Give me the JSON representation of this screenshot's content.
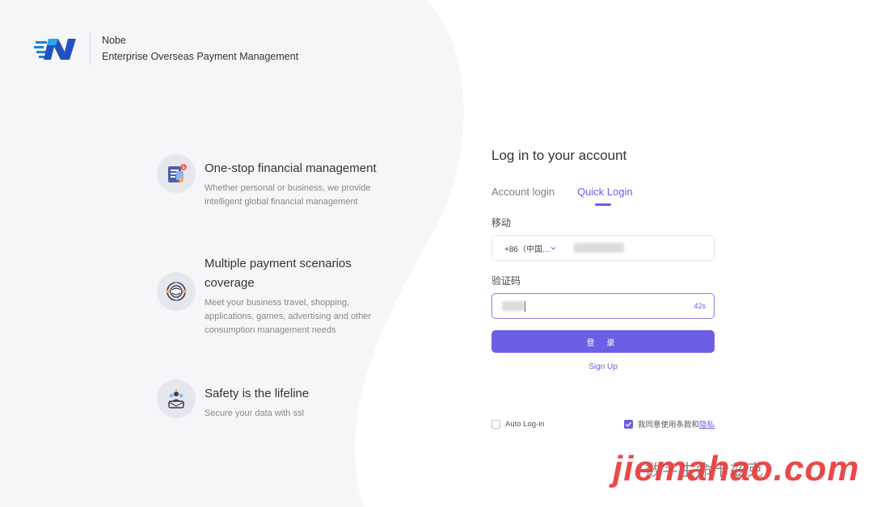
{
  "brand": {
    "name": "Nobe",
    "tagline": "Enterprise Overseas Payment Management"
  },
  "features": [
    {
      "title": "One-stop financial management",
      "desc": "Whether personal or business, we provide intelligent global financial management",
      "icon": "financial-document-icon"
    },
    {
      "title": "Multiple payment scenarios coverage",
      "desc": "Meet your business travel, shopping, applications, games, advertising and other consumption management needs",
      "icon": "globe-payment-icon"
    },
    {
      "title": "Safety is the lifeline",
      "desc": "Secure your data with ssl",
      "icon": "security-users-icon"
    }
  ],
  "login": {
    "title": "Log in to your account",
    "tabs": [
      "Account login",
      "Quick Login"
    ],
    "active_tab": "Quick Login",
    "phone_label": "移动",
    "phone_prefix": "+86（中国...",
    "code_label": "验证码",
    "countdown": "42s",
    "submit_label": "登 录",
    "signup_label": "Sign Up",
    "auto_login_label": "Auto Log-in",
    "auto_login_checked": false,
    "agree_label": "我同意使用条款和",
    "privacy_link": "隐私",
    "agree_checked": true
  },
  "watermark": {
    "main": "jiemahao.com",
    "sub": "数字生命卡兹克"
  },
  "colors": {
    "accent": "#6c5fe4",
    "left_bg": "#f5f6f8",
    "watermark": "#ea4040"
  }
}
